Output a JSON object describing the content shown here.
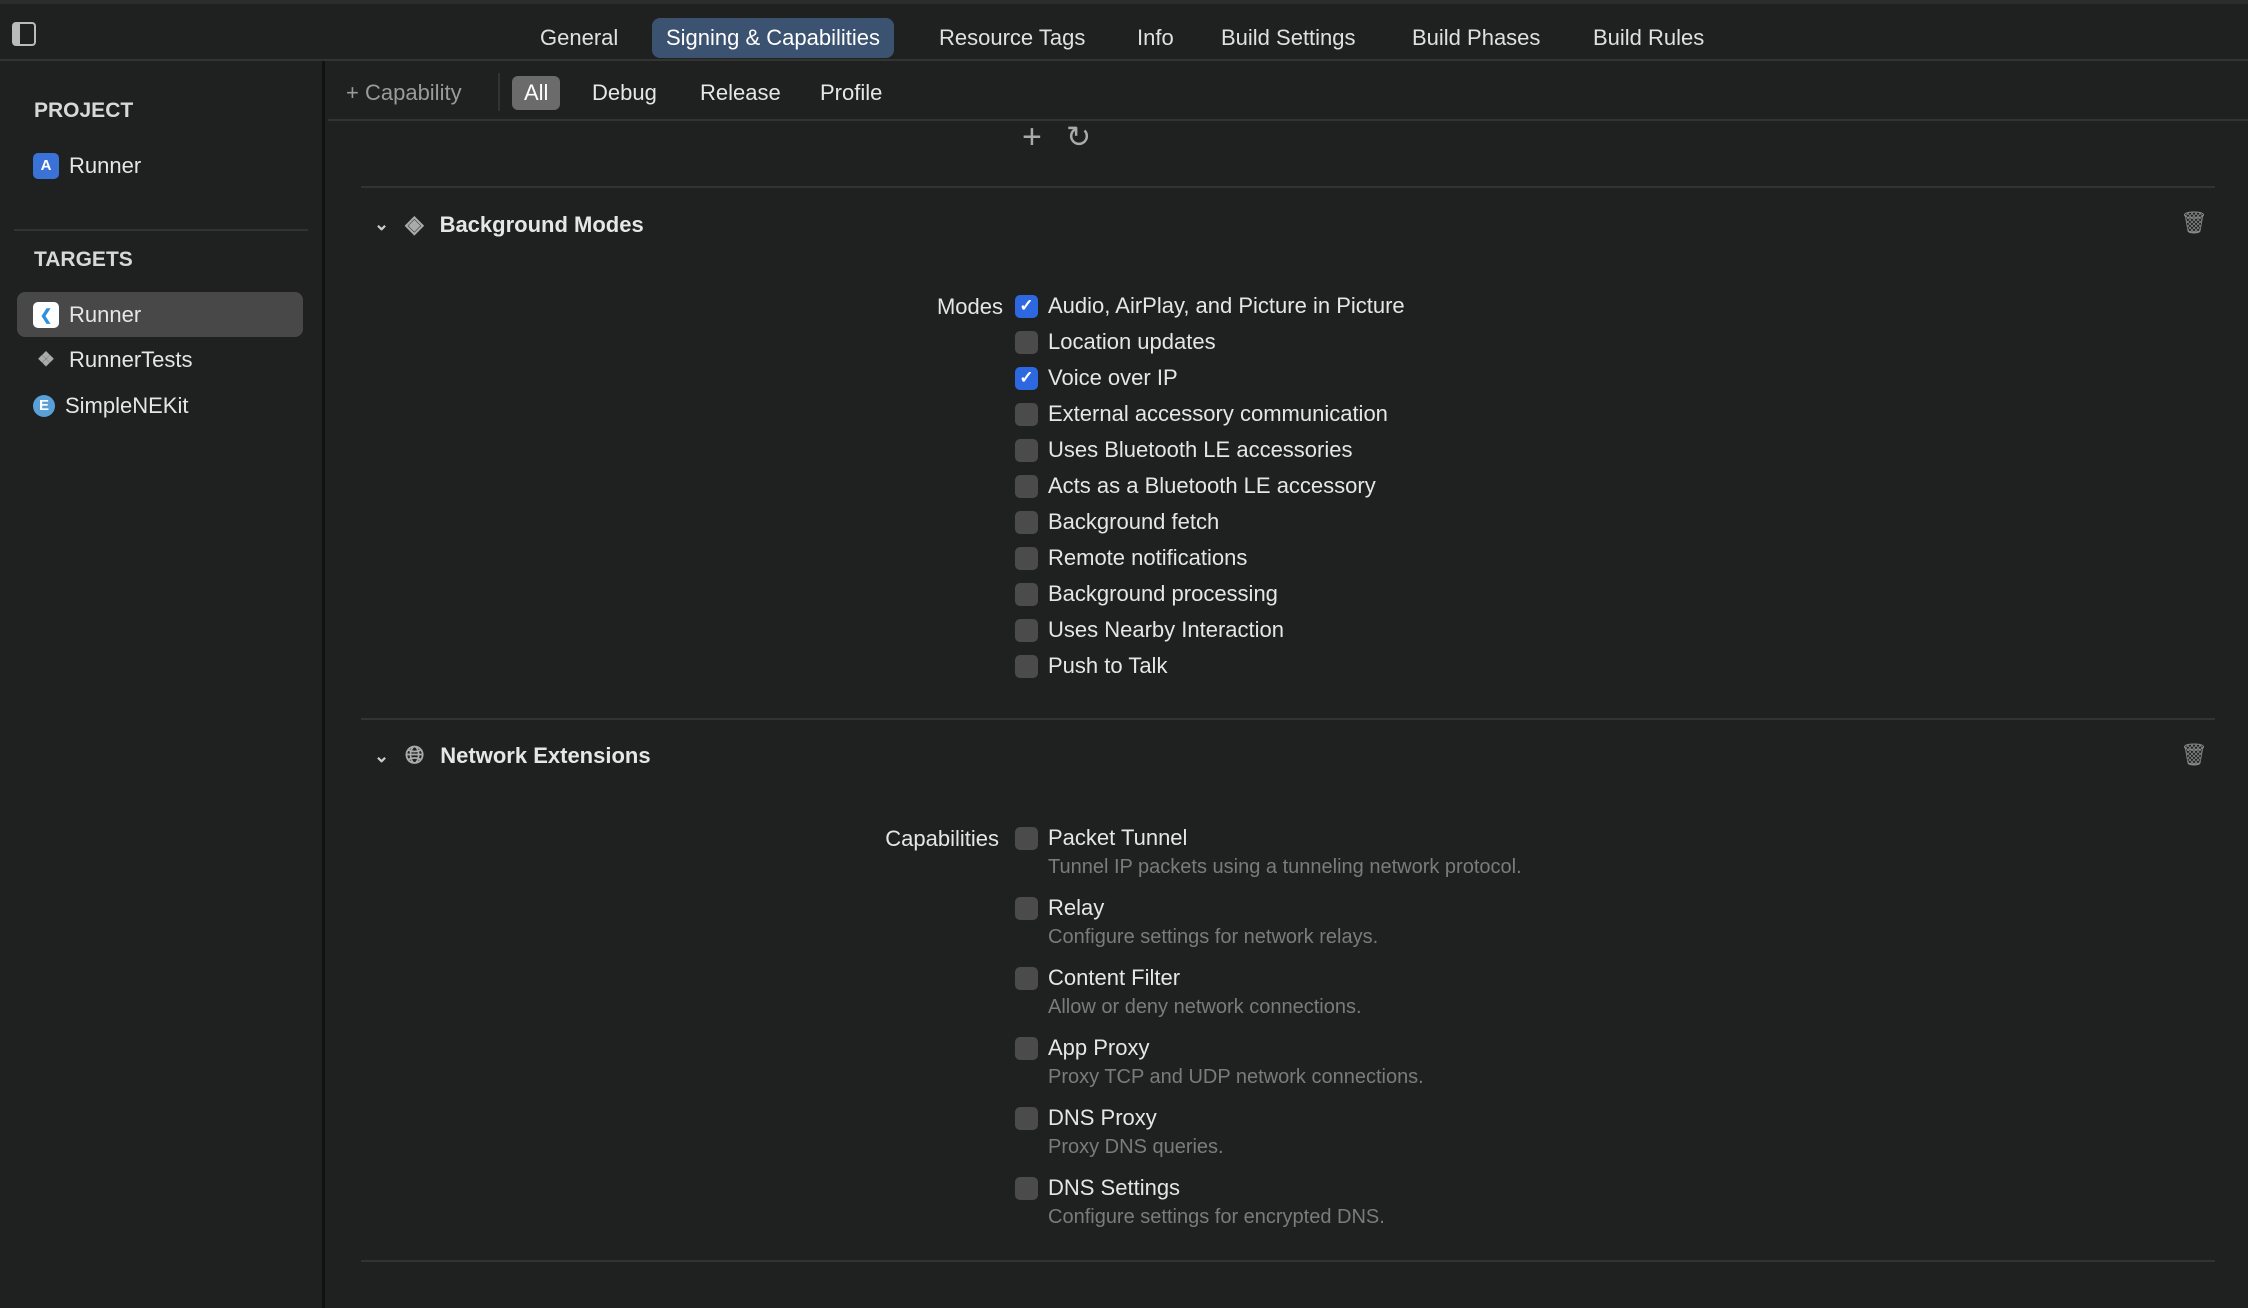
{
  "tabs": [
    "General",
    "Signing & Capabilities",
    "Resource Tags",
    "Info",
    "Build Settings",
    "Build Phases",
    "Build Rules"
  ],
  "sidebar": {
    "project_header": "PROJECT",
    "project": "Runner",
    "targets_header": "TARGETS",
    "targets": [
      "Runner",
      "RunnerTests",
      "SimpleNEKit"
    ]
  },
  "toolbar": {
    "add_capability": "Capability",
    "filters": [
      "All",
      "Debug",
      "Release",
      "Profile"
    ]
  },
  "background_modes": {
    "title": "Background Modes",
    "label": "Modes",
    "items": [
      {
        "label": "Audio, AirPlay, and Picture in Picture",
        "checked": true
      },
      {
        "label": "Location updates",
        "checked": false
      },
      {
        "label": "Voice over IP",
        "checked": true
      },
      {
        "label": "External accessory communication",
        "checked": false
      },
      {
        "label": "Uses Bluetooth LE accessories",
        "checked": false
      },
      {
        "label": "Acts as a Bluetooth LE accessory",
        "checked": false
      },
      {
        "label": "Background fetch",
        "checked": false
      },
      {
        "label": "Remote notifications",
        "checked": false
      },
      {
        "label": "Background processing",
        "checked": false
      },
      {
        "label": "Uses Nearby Interaction",
        "checked": false
      },
      {
        "label": "Push to Talk",
        "checked": false
      }
    ]
  },
  "network_extensions": {
    "title": "Network Extensions",
    "label": "Capabilities",
    "items": [
      {
        "label": "Packet Tunnel",
        "desc": "Tunnel IP packets using a tunneling network protocol.",
        "checked": false
      },
      {
        "label": "Relay",
        "desc": "Configure settings for network relays.",
        "checked": false
      },
      {
        "label": "Content Filter",
        "desc": "Allow or deny network connections.",
        "checked": false
      },
      {
        "label": "App Proxy",
        "desc": "Proxy TCP and UDP network connections.",
        "checked": false
      },
      {
        "label": "DNS Proxy",
        "desc": "Proxy DNS queries.",
        "checked": false
      },
      {
        "label": "DNS Settings",
        "desc": "Configure settings for encrypted DNS.",
        "checked": false
      }
    ]
  }
}
